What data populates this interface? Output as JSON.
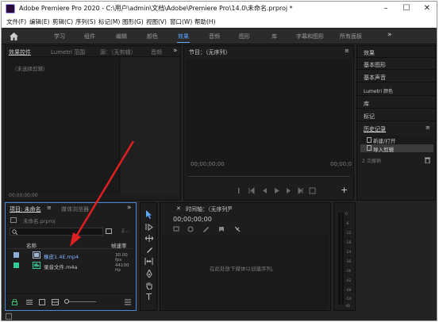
{
  "window": {
    "title": "Adobe Premiere Pro 2020 - C:\\用户\\admin\\文档\\Adobe\\Premiere Pro\\14.0\\未命名.prproj *",
    "minimize": "–",
    "restore": "☐",
    "close": "✕"
  },
  "menu": [
    "文件(F)",
    "编辑(E)",
    "剪辑(C)",
    "序列(S)",
    "标记(M)",
    "图形(G)",
    "视图(V)",
    "窗口(W)",
    "帮助(H)"
  ],
  "workspaces": {
    "home_icon": "home-icon",
    "tabs": [
      "学习",
      "组件",
      "编辑",
      "颜色",
      "效果",
      "音频",
      "图形",
      "库",
      "字幕和图形",
      "所有面板"
    ],
    "active_index": 4,
    "more": "»"
  },
  "source_panel": {
    "tabs": [
      "效果控件",
      "Lumetri 范围",
      "源：（无剪辑）",
      "音频"
    ],
    "more": "»",
    "menu": "≡",
    "no_clip": "（未选择剪辑）",
    "timecode": "00;00;00;00"
  },
  "program_panel": {
    "title": "节目：（无序列）",
    "menu": "≡",
    "timecode_left": "00;00;00;00",
    "timecode_right": "00;00;0"
  },
  "right_panel": {
    "items": [
      "效果",
      "基本图形",
      "基本声音",
      "Lumetri 颜色",
      "库",
      "标记"
    ],
    "history_title": "历史记录",
    "history_menu": "≡",
    "history_entries": [
      "新建/打开",
      "导入剪辑"
    ],
    "undo_count": "2 次撤销"
  },
  "project_panel": {
    "tabs": [
      "项目: 未命名",
      "媒体浏览器"
    ],
    "menu": "≡",
    "more": "»",
    "project_file": "未命名.prproj",
    "item_count": "2...",
    "col_name": "名称",
    "col_framerate": "帧速率",
    "rows": [
      {
        "name": "橡皮1.4E.mp4",
        "rate": "30.00 fps",
        "color": "#8aaed6"
      },
      {
        "name": "录音文件.m4a",
        "rate": "44100 Hz",
        "color": "#33cc99"
      }
    ]
  },
  "timeline_panel": {
    "title": "时间轴：（无序列）",
    "menu": "≡",
    "timecode": "00;00;00;00",
    "empty_msg": "在此处放下媒体以创建序列。"
  },
  "audio_meter": {
    "scale": [
      "0",
      "-6",
      "-12",
      "-18",
      "-24",
      "-30",
      "-36",
      "-42",
      "-48",
      "-54",
      "dB"
    ]
  },
  "colors": {
    "accent": "#5aa9ff",
    "panel_bg": "#1d1d1d",
    "app_bg": "#232323",
    "arrow": "#e02020"
  }
}
